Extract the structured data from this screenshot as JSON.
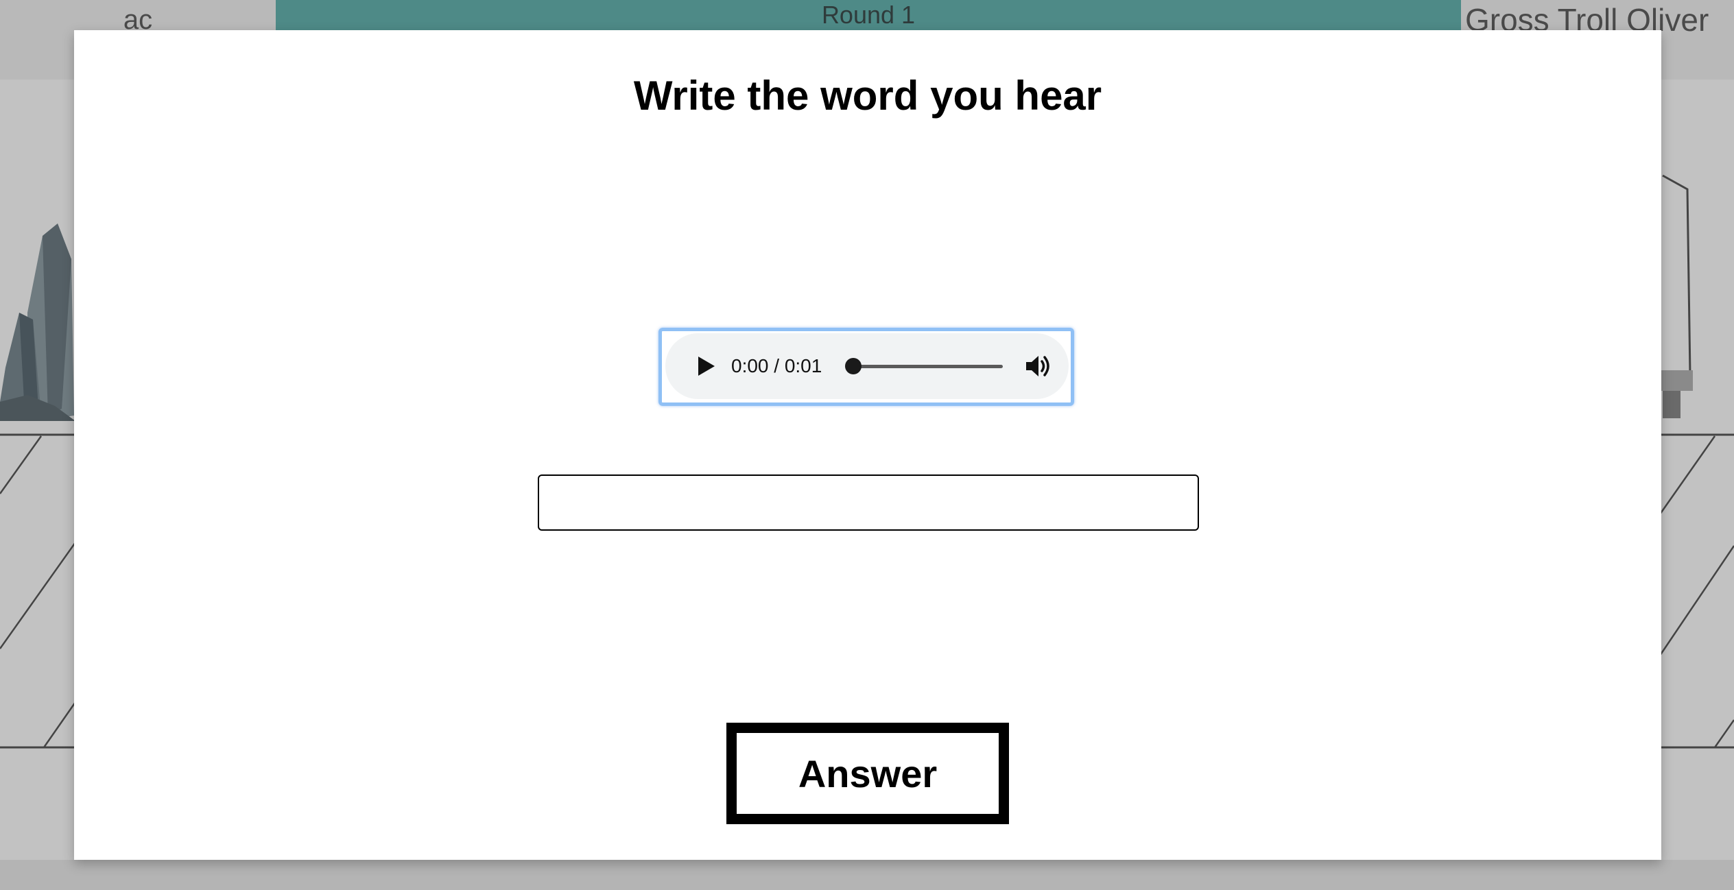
{
  "header": {
    "player_left": "ac",
    "round_label": "Round 1",
    "player_right": "Gross Troll Oliver"
  },
  "modal": {
    "title": "Write the word you hear",
    "audio": {
      "time_display": "0:00 / 0:01",
      "progress": 0
    },
    "answer_input": {
      "value": "",
      "placeholder": ""
    },
    "answer_button_label": "Answer"
  },
  "colors": {
    "round_bar": "#4e8a87",
    "background": "#c2c2c2",
    "focus_ring": "#8fc0f5"
  },
  "icons": [
    "play-icon",
    "volume-icon",
    "crystal-rock-decoration"
  ]
}
